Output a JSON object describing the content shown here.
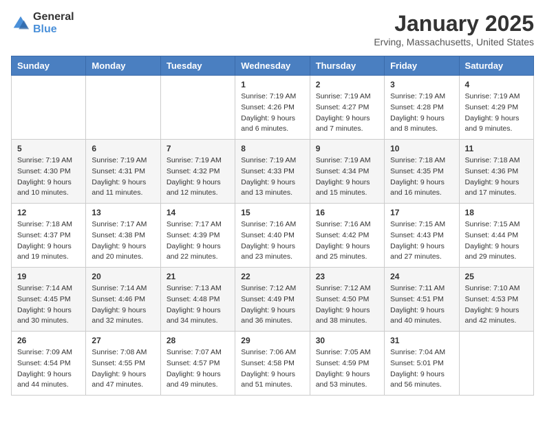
{
  "logo": {
    "text_general": "General",
    "text_blue": "Blue"
  },
  "title": {
    "month_year": "January 2025",
    "location": "Erving, Massachusetts, United States"
  },
  "headers": [
    "Sunday",
    "Monday",
    "Tuesday",
    "Wednesday",
    "Thursday",
    "Friday",
    "Saturday"
  ],
  "weeks": [
    [
      {
        "day": "",
        "lines": []
      },
      {
        "day": "",
        "lines": []
      },
      {
        "day": "",
        "lines": []
      },
      {
        "day": "1",
        "lines": [
          "Sunrise: 7:19 AM",
          "Sunset: 4:26 PM",
          "Daylight: 9 hours",
          "and 6 minutes."
        ]
      },
      {
        "day": "2",
        "lines": [
          "Sunrise: 7:19 AM",
          "Sunset: 4:27 PM",
          "Daylight: 9 hours",
          "and 7 minutes."
        ]
      },
      {
        "day": "3",
        "lines": [
          "Sunrise: 7:19 AM",
          "Sunset: 4:28 PM",
          "Daylight: 9 hours",
          "and 8 minutes."
        ]
      },
      {
        "day": "4",
        "lines": [
          "Sunrise: 7:19 AM",
          "Sunset: 4:29 PM",
          "Daylight: 9 hours",
          "and 9 minutes."
        ]
      }
    ],
    [
      {
        "day": "5",
        "lines": [
          "Sunrise: 7:19 AM",
          "Sunset: 4:30 PM",
          "Daylight: 9 hours",
          "and 10 minutes."
        ]
      },
      {
        "day": "6",
        "lines": [
          "Sunrise: 7:19 AM",
          "Sunset: 4:31 PM",
          "Daylight: 9 hours",
          "and 11 minutes."
        ]
      },
      {
        "day": "7",
        "lines": [
          "Sunrise: 7:19 AM",
          "Sunset: 4:32 PM",
          "Daylight: 9 hours",
          "and 12 minutes."
        ]
      },
      {
        "day": "8",
        "lines": [
          "Sunrise: 7:19 AM",
          "Sunset: 4:33 PM",
          "Daylight: 9 hours",
          "and 13 minutes."
        ]
      },
      {
        "day": "9",
        "lines": [
          "Sunrise: 7:19 AM",
          "Sunset: 4:34 PM",
          "Daylight: 9 hours",
          "and 15 minutes."
        ]
      },
      {
        "day": "10",
        "lines": [
          "Sunrise: 7:18 AM",
          "Sunset: 4:35 PM",
          "Daylight: 9 hours",
          "and 16 minutes."
        ]
      },
      {
        "day": "11",
        "lines": [
          "Sunrise: 7:18 AM",
          "Sunset: 4:36 PM",
          "Daylight: 9 hours",
          "and 17 minutes."
        ]
      }
    ],
    [
      {
        "day": "12",
        "lines": [
          "Sunrise: 7:18 AM",
          "Sunset: 4:37 PM",
          "Daylight: 9 hours",
          "and 19 minutes."
        ]
      },
      {
        "day": "13",
        "lines": [
          "Sunrise: 7:17 AM",
          "Sunset: 4:38 PM",
          "Daylight: 9 hours",
          "and 20 minutes."
        ]
      },
      {
        "day": "14",
        "lines": [
          "Sunrise: 7:17 AM",
          "Sunset: 4:39 PM",
          "Daylight: 9 hours",
          "and 22 minutes."
        ]
      },
      {
        "day": "15",
        "lines": [
          "Sunrise: 7:16 AM",
          "Sunset: 4:40 PM",
          "Daylight: 9 hours",
          "and 23 minutes."
        ]
      },
      {
        "day": "16",
        "lines": [
          "Sunrise: 7:16 AM",
          "Sunset: 4:42 PM",
          "Daylight: 9 hours",
          "and 25 minutes."
        ]
      },
      {
        "day": "17",
        "lines": [
          "Sunrise: 7:15 AM",
          "Sunset: 4:43 PM",
          "Daylight: 9 hours",
          "and 27 minutes."
        ]
      },
      {
        "day": "18",
        "lines": [
          "Sunrise: 7:15 AM",
          "Sunset: 4:44 PM",
          "Daylight: 9 hours",
          "and 29 minutes."
        ]
      }
    ],
    [
      {
        "day": "19",
        "lines": [
          "Sunrise: 7:14 AM",
          "Sunset: 4:45 PM",
          "Daylight: 9 hours",
          "and 30 minutes."
        ]
      },
      {
        "day": "20",
        "lines": [
          "Sunrise: 7:14 AM",
          "Sunset: 4:46 PM",
          "Daylight: 9 hours",
          "and 32 minutes."
        ]
      },
      {
        "day": "21",
        "lines": [
          "Sunrise: 7:13 AM",
          "Sunset: 4:48 PM",
          "Daylight: 9 hours",
          "and 34 minutes."
        ]
      },
      {
        "day": "22",
        "lines": [
          "Sunrise: 7:12 AM",
          "Sunset: 4:49 PM",
          "Daylight: 9 hours",
          "and 36 minutes."
        ]
      },
      {
        "day": "23",
        "lines": [
          "Sunrise: 7:12 AM",
          "Sunset: 4:50 PM",
          "Daylight: 9 hours",
          "and 38 minutes."
        ]
      },
      {
        "day": "24",
        "lines": [
          "Sunrise: 7:11 AM",
          "Sunset: 4:51 PM",
          "Daylight: 9 hours",
          "and 40 minutes."
        ]
      },
      {
        "day": "25",
        "lines": [
          "Sunrise: 7:10 AM",
          "Sunset: 4:53 PM",
          "Daylight: 9 hours",
          "and 42 minutes."
        ]
      }
    ],
    [
      {
        "day": "26",
        "lines": [
          "Sunrise: 7:09 AM",
          "Sunset: 4:54 PM",
          "Daylight: 9 hours",
          "and 44 minutes."
        ]
      },
      {
        "day": "27",
        "lines": [
          "Sunrise: 7:08 AM",
          "Sunset: 4:55 PM",
          "Daylight: 9 hours",
          "and 47 minutes."
        ]
      },
      {
        "day": "28",
        "lines": [
          "Sunrise: 7:07 AM",
          "Sunset: 4:57 PM",
          "Daylight: 9 hours",
          "and 49 minutes."
        ]
      },
      {
        "day": "29",
        "lines": [
          "Sunrise: 7:06 AM",
          "Sunset: 4:58 PM",
          "Daylight: 9 hours",
          "and 51 minutes."
        ]
      },
      {
        "day": "30",
        "lines": [
          "Sunrise: 7:05 AM",
          "Sunset: 4:59 PM",
          "Daylight: 9 hours",
          "and 53 minutes."
        ]
      },
      {
        "day": "31",
        "lines": [
          "Sunrise: 7:04 AM",
          "Sunset: 5:01 PM",
          "Daylight: 9 hours",
          "and 56 minutes."
        ]
      },
      {
        "day": "",
        "lines": []
      }
    ]
  ]
}
